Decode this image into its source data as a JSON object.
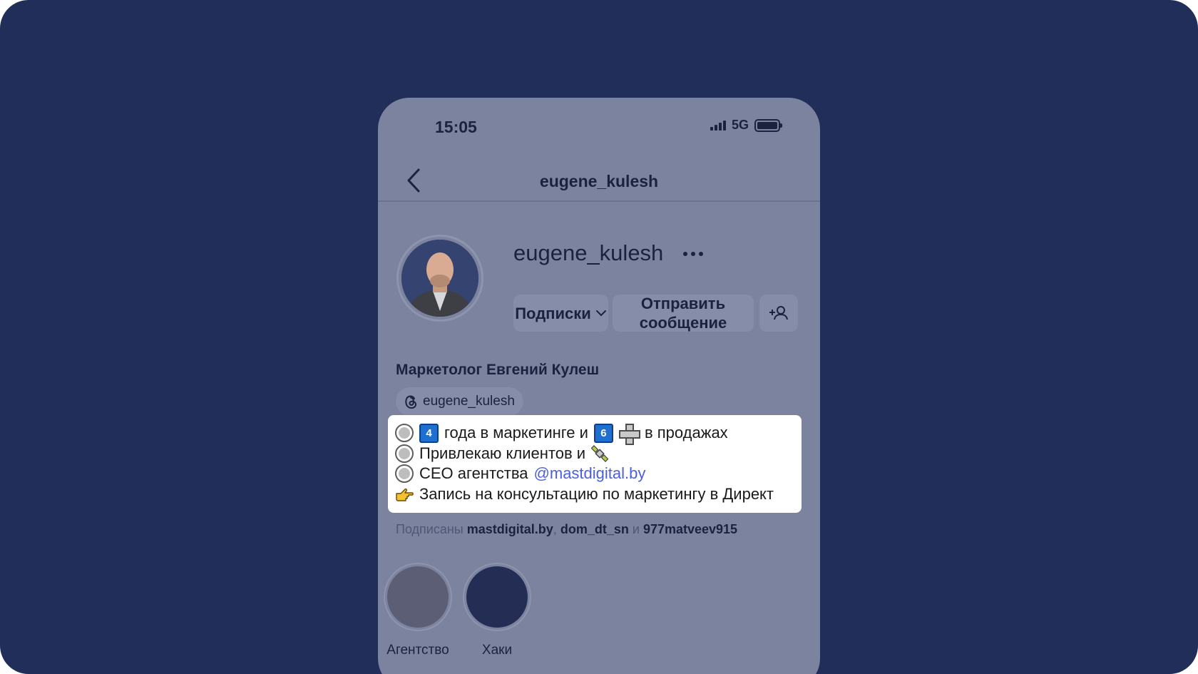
{
  "status": {
    "time": "15:05",
    "network": "5G"
  },
  "nav": {
    "title": "eugene_kulesh"
  },
  "profile": {
    "username": "eugene_kulesh",
    "buttons": {
      "following": "Подписки",
      "message": "Отправить сообщение"
    },
    "full_name": "Маркетолог Евгений Кулеш",
    "threads_handle": "eugene_kulesh"
  },
  "bio": {
    "line1_a": "года в маркетинге и",
    "line1_b": "в продажах",
    "num4": "4",
    "num6": "6",
    "line2": "Привлекаю клиентов и",
    "line3": "CEO агентства",
    "line3_link": "@mastdigital.by",
    "line4": "Запись на консультацию по маркетингу в Директ"
  },
  "followed_by": {
    "prefix": "Подписаны",
    "user1": "mastdigital.by",
    "user2": "dom_dt_sn",
    "conj": "и",
    "user3": "977matveev915"
  },
  "highlights": [
    {
      "label": "Агентство",
      "color": "#5c5e76"
    },
    {
      "label": "Хаки",
      "color": "#242d54"
    }
  ],
  "colors": {
    "background": "#202e59",
    "overlay": "#7c839f",
    "link": "#4b5fe0"
  }
}
